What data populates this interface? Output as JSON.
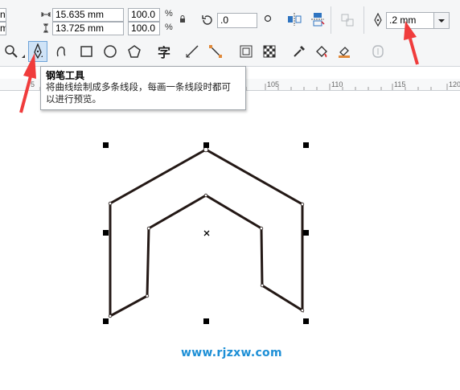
{
  "property_bar": {
    "width_value": "15.635 mm",
    "height_value": "13.725 mm",
    "left_partial_top": "n",
    "left_partial_bottom": "m",
    "scale_x": "100.0",
    "scale_y": "100.0",
    "percent_symbol": "%",
    "rotation_value": ".0",
    "outline_width_value": ".2 mm"
  },
  "toolbox": {
    "active_tool": "pen-tool",
    "text_tool_glyph": "字"
  },
  "ruler": {
    "labels": [
      "5",
      "105",
      "110",
      "115",
      "120"
    ]
  },
  "tooltip": {
    "title": "钢笔工具",
    "line1": "将曲线绘制成多条线段，每画一条线段时都可",
    "line2": "以进行预览。"
  },
  "watermark": "www.rjzxw.com",
  "colors": {
    "annotation_arrow": "#f03c3c",
    "shape_outline": "#231815",
    "watermark": "#1d8fd6"
  }
}
